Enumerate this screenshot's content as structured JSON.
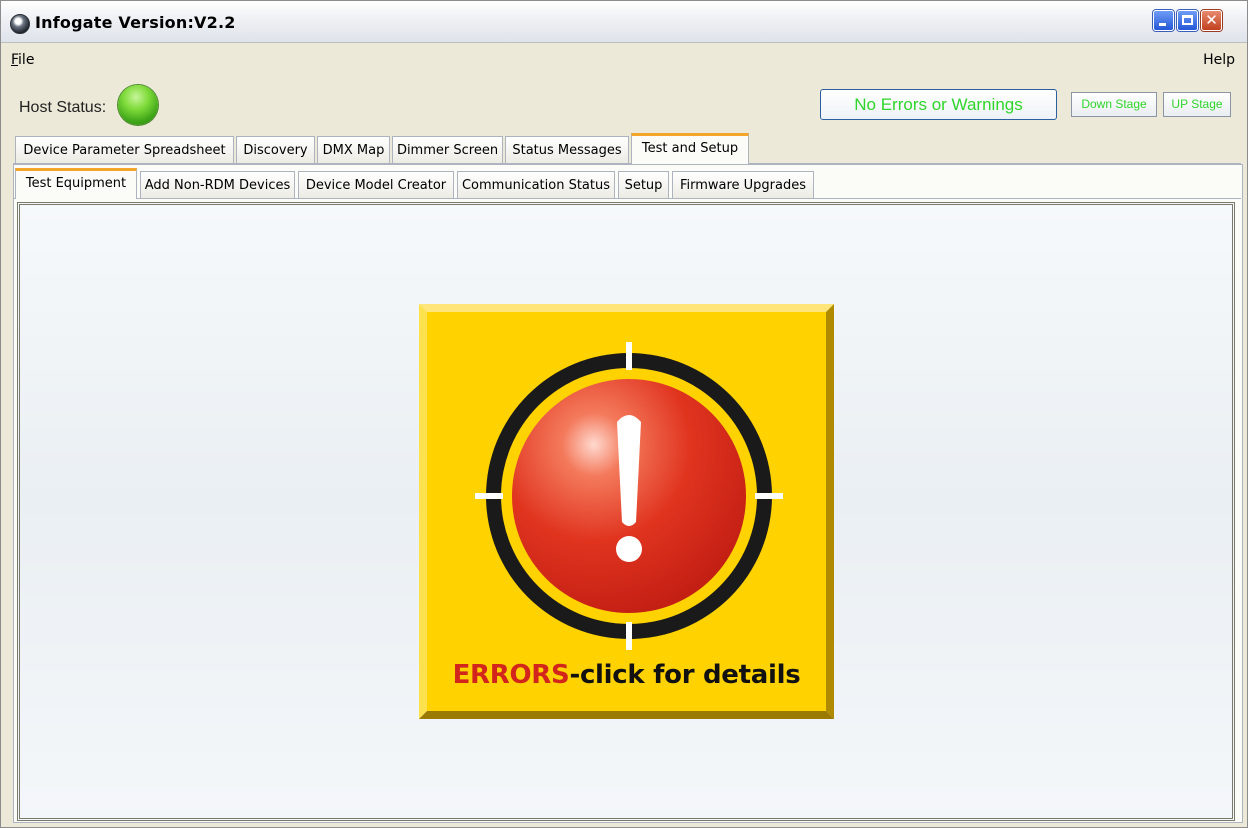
{
  "window": {
    "title": "Infogate Version:V2.2"
  },
  "menu": {
    "file_underlined": "F",
    "file_rest": "ile",
    "help": "Help"
  },
  "status": {
    "host_label": "Host Status:",
    "host_indicator_color": "#56c51f",
    "warnings_button": "No Errors or Warnings",
    "down_stage": "Down Stage",
    "up_stage": "UP Stage",
    "status_text_color": "#2fd52a"
  },
  "main_tabs": [
    "Device Parameter Spreadsheet",
    "Discovery",
    "DMX Map",
    "Dimmer Screen",
    "Status Messages",
    "Test and Setup"
  ],
  "main_tab_selected": "Test and Setup",
  "sub_tabs": [
    "Test Equipment",
    "Add Non-RDM Devices",
    "Device Model Creator",
    "Communication Status",
    "Setup",
    "Firmware Upgrades"
  ],
  "sub_tab_selected": "Test Equipment",
  "error_badge": {
    "errors_word": "ERRORS",
    "rest": "-click for details",
    "background_color": "#ffd200",
    "ball_color": "#dc2a1c",
    "icon": "exclamation-target-icon"
  }
}
